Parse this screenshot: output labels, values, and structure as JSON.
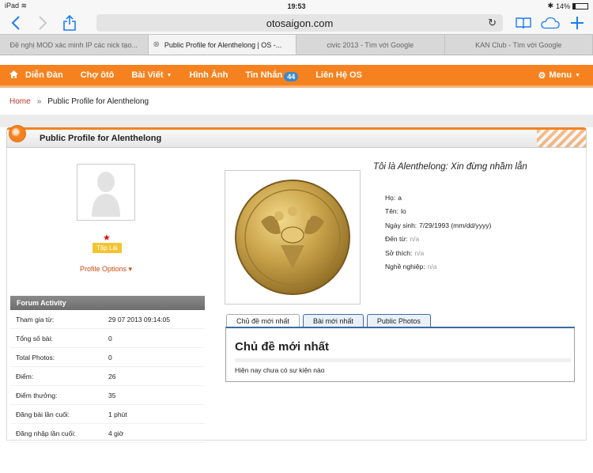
{
  "status": {
    "device": "iPad",
    "time": "19:53",
    "battery": "14%"
  },
  "browser": {
    "url": "otosaigon.com",
    "tabs": [
      {
        "label": "Đề nghị MOD xác minh IP các nick tạo...",
        "active": false
      },
      {
        "label": "Public Profile for Alenthelong | OS -...",
        "active": true
      },
      {
        "label": "civic 2013 - Tìm với Google",
        "active": false
      },
      {
        "label": "KAN Club - Tìm với Google",
        "active": false
      }
    ]
  },
  "nav": {
    "items": [
      {
        "label": "Diễn Đàn",
        "caret": false
      },
      {
        "label": "Chợ ôtô",
        "caret": false
      },
      {
        "label": "Bài Viết",
        "caret": true
      },
      {
        "label": "Hình Ảnh",
        "caret": false
      },
      {
        "label": "Tin Nhắn",
        "caret": false,
        "badge": "44"
      },
      {
        "label": "Liên Hệ OS",
        "caret": false
      }
    ],
    "menu_label": "Menu"
  },
  "breadcrumb": {
    "home": "Home",
    "separator": "»",
    "current": "Public Profile for Alenthelong"
  },
  "profile": {
    "panel_title": "Public Profile for Alenthelong",
    "rank_badge": "Tập Lái",
    "options_label": "Profile Options",
    "tagline": "Tôi là Alenthelong: Xin đừng nhầm lẫn",
    "info": [
      {
        "label": "Họ:",
        "value": "a",
        "na": false
      },
      {
        "label": "Tên:",
        "value": "lo",
        "na": false
      },
      {
        "label": "Ngày sinh:",
        "value": "7/29/1993 (mm/dd/yyyy)",
        "na": false
      },
      {
        "label": "Đến từ:",
        "value": "n/a",
        "na": true
      },
      {
        "label": "Sở thích:",
        "value": "n/a",
        "na": true
      },
      {
        "label": "Nghề nghiệp:",
        "value": "n/a",
        "na": true
      }
    ],
    "forum_activity": {
      "header": "Forum Activity",
      "rows": [
        {
          "label": "Tham gia từ:",
          "value": "29 07 2013 09:14:05"
        },
        {
          "label": "Tổng số bài:",
          "value": "0"
        },
        {
          "label": "Total Photos:",
          "value": "0"
        },
        {
          "label": "Điểm:",
          "value": "26"
        },
        {
          "label": "Điểm thưởng:",
          "value": "35"
        },
        {
          "label": "Đăng bài lần cuối:",
          "value": "1 phút"
        },
        {
          "label": "Đăng nhập lần cuối:",
          "value": "4 giờ"
        }
      ]
    },
    "content_tabs": [
      "Chủ đề mới nhất",
      "Bài mới nhất",
      "Public Photos"
    ],
    "content": {
      "heading": "Chủ đề mới nhất",
      "empty_text": "Hiện nay chưa có sự kiện nào"
    }
  },
  "colors": {
    "nav_orange": "#f5821f",
    "ios_blue": "#1e7cf2",
    "tab_blue": "#3d6aa2"
  }
}
